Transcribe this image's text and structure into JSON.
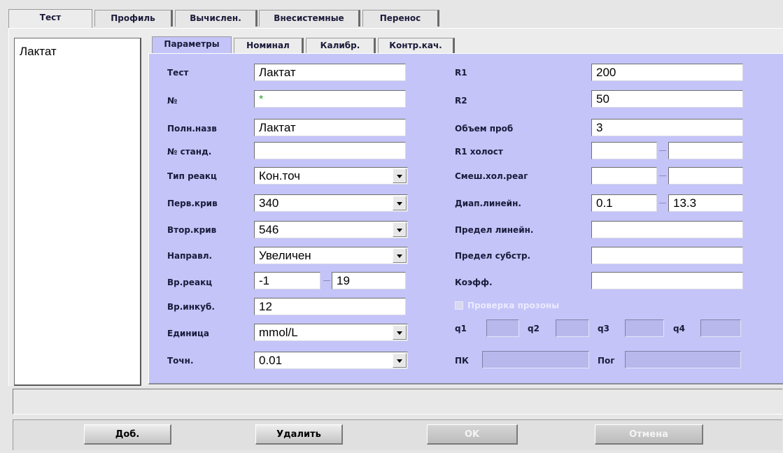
{
  "top_tabs": [
    "Тест",
    "Профиль",
    "Вычислен.",
    "Внесистемные",
    "Перенос"
  ],
  "test_list": [
    "Лактат"
  ],
  "sub_tabs": [
    "Параметры",
    "Номинал",
    "Калибр.",
    "Контр.кач."
  ],
  "left": {
    "test": {
      "label": "Тест",
      "value": "Лактат"
    },
    "number": {
      "label": "№",
      "value": "*"
    },
    "full_name": {
      "label": "Полн.назв",
      "value": "Лактат"
    },
    "std_number": {
      "label": "№ станд.",
      "value": ""
    },
    "reaction_type": {
      "label": "Тип реакц",
      "value": "Кон.точ"
    },
    "primary_wave": {
      "label": "Перв.крив",
      "value": "340"
    },
    "secondary_wave": {
      "label": "Втор.крив",
      "value": "546"
    },
    "direction": {
      "label": "Направл.",
      "value": "Увеличен"
    },
    "reaction_time": {
      "label": "Вр.реакц",
      "from": "-1",
      "to": "19"
    },
    "incubation_time": {
      "label": "Вр.инкуб.",
      "value": "12"
    },
    "unit": {
      "label": "Единица",
      "value": "mmol/L"
    },
    "precision": {
      "label": "Точн.",
      "value": "0.01"
    }
  },
  "right": {
    "r1": {
      "label": "R1",
      "value": "200"
    },
    "r2": {
      "label": "R2",
      "value": "50"
    },
    "sample_volume": {
      "label": "Объем проб",
      "value": "3"
    },
    "r1_blank": {
      "label": "R1 холост",
      "from": "",
      "to": ""
    },
    "mixed_blank": {
      "label": "Смеш.хол.реаг",
      "from": "",
      "to": ""
    },
    "linear_range": {
      "label": "Диап.линейн.",
      "from": "0.1",
      "to": "13.3"
    },
    "linear_limit": {
      "label": "Предел линейн.",
      "value": ""
    },
    "substrate_limit": {
      "label": "Предел субстр.",
      "value": ""
    },
    "coefficient": {
      "label": "Коэфф.",
      "value": ""
    },
    "prozone_check": {
      "label": "Проверка прозоны",
      "checked": false
    },
    "q_labels": [
      "q1",
      "q2",
      "q3",
      "q4"
    ],
    "pk": {
      "label": "ПК",
      "value": ""
    },
    "pog": {
      "label": "Пог",
      "value": ""
    }
  },
  "buttons": {
    "add": "Доб.",
    "delete": "Удалить",
    "ok": "OK",
    "cancel": "Отмена"
  },
  "colors": {
    "panel": "#c4c4f8",
    "background": "#e6e6e6",
    "star": "#2aa52a"
  }
}
